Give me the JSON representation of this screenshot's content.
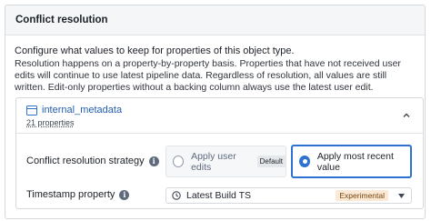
{
  "panel": {
    "title": "Conflict resolution",
    "description_line": "Configure what values to keep for properties of this object type.",
    "description_detail": "Resolution happens on a property-by-property basis. Properties that have not received user edits will continue to use latest pipeline data. Regardless of resolution, all values are still written. Edit-only properties without a backing column always use the latest user edit."
  },
  "object": {
    "name": "internal_metadata",
    "properties_link": "21 properties",
    "icon": "table-icon",
    "collapse_icon": "chevron-up-icon"
  },
  "strategy": {
    "label": "Conflict resolution strategy",
    "info_icon": "info-icon",
    "options": [
      {
        "label": "Apply user edits",
        "tag": "Default",
        "selected": false
      },
      {
        "label": "Apply most recent value",
        "selected": true
      }
    ]
  },
  "timestamp": {
    "label": "Timestamp property",
    "info_icon": "info-icon",
    "value": "Latest Build TS",
    "value_icon": "clock-icon",
    "tag": "Experimental",
    "caret_icon": "caret-down-icon"
  },
  "colors": {
    "accent": "#2d72d2",
    "link": "#215db0",
    "experimental_bg": "#fbe9d6",
    "experimental_text": "#77450d"
  }
}
